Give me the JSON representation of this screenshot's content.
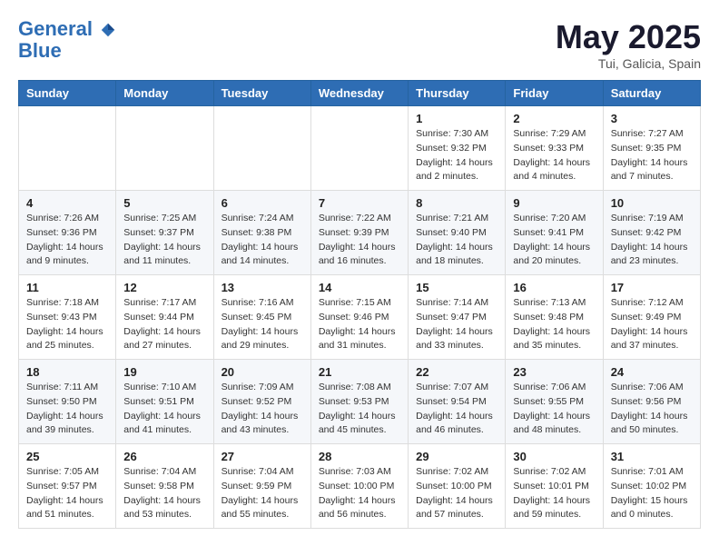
{
  "header": {
    "logo_line1": "General",
    "logo_line2": "Blue",
    "month": "May 2025",
    "location": "Tui, Galicia, Spain"
  },
  "weekdays": [
    "Sunday",
    "Monday",
    "Tuesday",
    "Wednesday",
    "Thursday",
    "Friday",
    "Saturday"
  ],
  "weeks": [
    [
      {
        "day": "",
        "info": ""
      },
      {
        "day": "",
        "info": ""
      },
      {
        "day": "",
        "info": ""
      },
      {
        "day": "",
        "info": ""
      },
      {
        "day": "1",
        "info": "Sunrise: 7:30 AM\nSunset: 9:32 PM\nDaylight: 14 hours\nand 2 minutes."
      },
      {
        "day": "2",
        "info": "Sunrise: 7:29 AM\nSunset: 9:33 PM\nDaylight: 14 hours\nand 4 minutes."
      },
      {
        "day": "3",
        "info": "Sunrise: 7:27 AM\nSunset: 9:35 PM\nDaylight: 14 hours\nand 7 minutes."
      }
    ],
    [
      {
        "day": "4",
        "info": "Sunrise: 7:26 AM\nSunset: 9:36 PM\nDaylight: 14 hours\nand 9 minutes."
      },
      {
        "day": "5",
        "info": "Sunrise: 7:25 AM\nSunset: 9:37 PM\nDaylight: 14 hours\nand 11 minutes."
      },
      {
        "day": "6",
        "info": "Sunrise: 7:24 AM\nSunset: 9:38 PM\nDaylight: 14 hours\nand 14 minutes."
      },
      {
        "day": "7",
        "info": "Sunrise: 7:22 AM\nSunset: 9:39 PM\nDaylight: 14 hours\nand 16 minutes."
      },
      {
        "day": "8",
        "info": "Sunrise: 7:21 AM\nSunset: 9:40 PM\nDaylight: 14 hours\nand 18 minutes."
      },
      {
        "day": "9",
        "info": "Sunrise: 7:20 AM\nSunset: 9:41 PM\nDaylight: 14 hours\nand 20 minutes."
      },
      {
        "day": "10",
        "info": "Sunrise: 7:19 AM\nSunset: 9:42 PM\nDaylight: 14 hours\nand 23 minutes."
      }
    ],
    [
      {
        "day": "11",
        "info": "Sunrise: 7:18 AM\nSunset: 9:43 PM\nDaylight: 14 hours\nand 25 minutes."
      },
      {
        "day": "12",
        "info": "Sunrise: 7:17 AM\nSunset: 9:44 PM\nDaylight: 14 hours\nand 27 minutes."
      },
      {
        "day": "13",
        "info": "Sunrise: 7:16 AM\nSunset: 9:45 PM\nDaylight: 14 hours\nand 29 minutes."
      },
      {
        "day": "14",
        "info": "Sunrise: 7:15 AM\nSunset: 9:46 PM\nDaylight: 14 hours\nand 31 minutes."
      },
      {
        "day": "15",
        "info": "Sunrise: 7:14 AM\nSunset: 9:47 PM\nDaylight: 14 hours\nand 33 minutes."
      },
      {
        "day": "16",
        "info": "Sunrise: 7:13 AM\nSunset: 9:48 PM\nDaylight: 14 hours\nand 35 minutes."
      },
      {
        "day": "17",
        "info": "Sunrise: 7:12 AM\nSunset: 9:49 PM\nDaylight: 14 hours\nand 37 minutes."
      }
    ],
    [
      {
        "day": "18",
        "info": "Sunrise: 7:11 AM\nSunset: 9:50 PM\nDaylight: 14 hours\nand 39 minutes."
      },
      {
        "day": "19",
        "info": "Sunrise: 7:10 AM\nSunset: 9:51 PM\nDaylight: 14 hours\nand 41 minutes."
      },
      {
        "day": "20",
        "info": "Sunrise: 7:09 AM\nSunset: 9:52 PM\nDaylight: 14 hours\nand 43 minutes."
      },
      {
        "day": "21",
        "info": "Sunrise: 7:08 AM\nSunset: 9:53 PM\nDaylight: 14 hours\nand 45 minutes."
      },
      {
        "day": "22",
        "info": "Sunrise: 7:07 AM\nSunset: 9:54 PM\nDaylight: 14 hours\nand 46 minutes."
      },
      {
        "day": "23",
        "info": "Sunrise: 7:06 AM\nSunset: 9:55 PM\nDaylight: 14 hours\nand 48 minutes."
      },
      {
        "day": "24",
        "info": "Sunrise: 7:06 AM\nSunset: 9:56 PM\nDaylight: 14 hours\nand 50 minutes."
      }
    ],
    [
      {
        "day": "25",
        "info": "Sunrise: 7:05 AM\nSunset: 9:57 PM\nDaylight: 14 hours\nand 51 minutes."
      },
      {
        "day": "26",
        "info": "Sunrise: 7:04 AM\nSunset: 9:58 PM\nDaylight: 14 hours\nand 53 minutes."
      },
      {
        "day": "27",
        "info": "Sunrise: 7:04 AM\nSunset: 9:59 PM\nDaylight: 14 hours\nand 55 minutes."
      },
      {
        "day": "28",
        "info": "Sunrise: 7:03 AM\nSunset: 10:00 PM\nDaylight: 14 hours\nand 56 minutes."
      },
      {
        "day": "29",
        "info": "Sunrise: 7:02 AM\nSunset: 10:00 PM\nDaylight: 14 hours\nand 57 minutes."
      },
      {
        "day": "30",
        "info": "Sunrise: 7:02 AM\nSunset: 10:01 PM\nDaylight: 14 hours\nand 59 minutes."
      },
      {
        "day": "31",
        "info": "Sunrise: 7:01 AM\nSunset: 10:02 PM\nDaylight: 15 hours\nand 0 minutes."
      }
    ]
  ]
}
